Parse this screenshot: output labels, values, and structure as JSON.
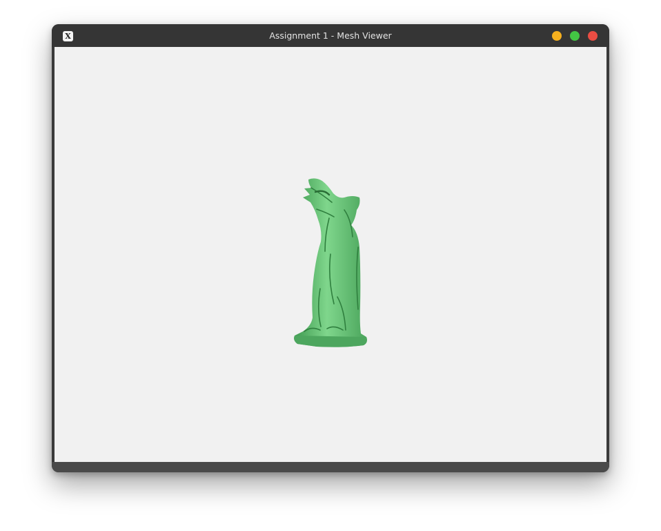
{
  "window": {
    "title": "Assignment 1 - Mesh Viewer",
    "app_icon_glyph": "X",
    "app_icon": "x11-app-icon",
    "buttons": {
      "minimize_icon": "minimize-circle-icon",
      "maximize_icon": "maximize-circle-icon",
      "close_icon": "close-circle-icon"
    }
  },
  "viewport": {
    "background_color": "#f1f1f1",
    "model": {
      "description_icon": "gargoyle-mesh",
      "color": "#5fbf6f"
    }
  },
  "colors": {
    "titlebar": "#353535",
    "minimize": "#f6b01e",
    "maximize": "#43c644",
    "close": "#ea4d43"
  }
}
